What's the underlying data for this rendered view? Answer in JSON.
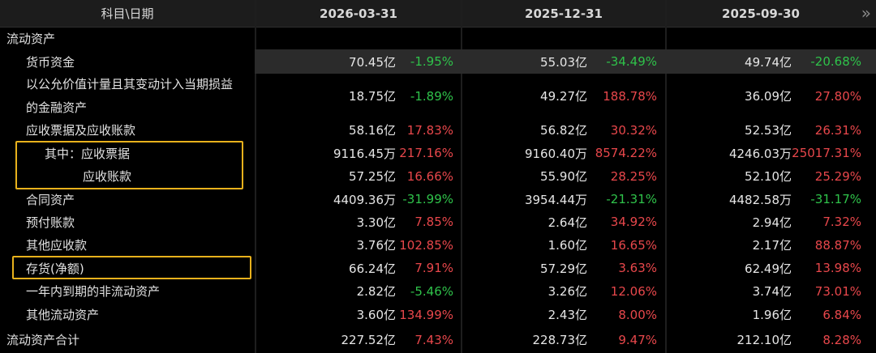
{
  "header": {
    "label": "科目\\日期",
    "columns": [
      "2026-03-31",
      "2025-12-31",
      "2025-09-30"
    ],
    "expand_icon": "»"
  },
  "rows": [
    {
      "label": "流动资产",
      "indent": 0,
      "cells": []
    },
    {
      "label": "货币资金",
      "indent": 1,
      "selected": true,
      "cells": [
        {
          "v": "70.45亿",
          "p": "-1.95%",
          "d": "down"
        },
        {
          "v": "55.03亿",
          "p": "-34.49%",
          "d": "down"
        },
        {
          "v": "49.74亿",
          "p": "-20.68%",
          "d": "down"
        }
      ]
    },
    {
      "label": "以公允价值计量且其变动计入当期损益",
      "label2": "的金融资产",
      "indent": 1,
      "cells": [
        {
          "v": "18.75亿",
          "p": "-1.89%",
          "d": "down"
        },
        {
          "v": "49.27亿",
          "p": "188.78%",
          "d": "up"
        },
        {
          "v": "36.09亿",
          "p": "27.80%",
          "d": "up"
        }
      ]
    },
    {
      "label": "应收票据及应收账款",
      "indent": 1,
      "cells": [
        {
          "v": "58.16亿",
          "p": "17.83%",
          "d": "up"
        },
        {
          "v": "56.82亿",
          "p": "30.32%",
          "d": "up"
        },
        {
          "v": "52.53亿",
          "p": "26.31%",
          "d": "up"
        }
      ]
    },
    {
      "label": "其中：应收票据",
      "indent": 2,
      "cells": [
        {
          "v": "9116.45万",
          "p": "217.16%",
          "d": "up"
        },
        {
          "v": "9160.40万",
          "p": "8574.22%",
          "d": "up"
        },
        {
          "v": "4246.03万",
          "p": "25017.31%",
          "d": "up"
        }
      ]
    },
    {
      "label": "应收账款",
      "indent": 3,
      "cells": [
        {
          "v": "57.25亿",
          "p": "16.66%",
          "d": "up"
        },
        {
          "v": "55.90亿",
          "p": "28.25%",
          "d": "up"
        },
        {
          "v": "52.10亿",
          "p": "25.29%",
          "d": "up"
        }
      ]
    },
    {
      "label": "合同资产",
      "indent": 1,
      "cells": [
        {
          "v": "4409.36万",
          "p": "-31.99%",
          "d": "down"
        },
        {
          "v": "3954.44万",
          "p": "-21.31%",
          "d": "down"
        },
        {
          "v": "4482.58万",
          "p": "-31.17%",
          "d": "down"
        }
      ]
    },
    {
      "label": "预付账款",
      "indent": 1,
      "cells": [
        {
          "v": "3.30亿",
          "p": "7.85%",
          "d": "up"
        },
        {
          "v": "2.64亿",
          "p": "34.92%",
          "d": "up"
        },
        {
          "v": "2.94亿",
          "p": "7.32%",
          "d": "up"
        }
      ]
    },
    {
      "label": "其他应收款",
      "indent": 1,
      "cells": [
        {
          "v": "3.76亿",
          "p": "102.85%",
          "d": "up"
        },
        {
          "v": "1.60亿",
          "p": "16.65%",
          "d": "up"
        },
        {
          "v": "2.17亿",
          "p": "88.87%",
          "d": "up"
        }
      ]
    },
    {
      "label": "存货(净额)",
      "indent": 1,
      "cells": [
        {
          "v": "66.24亿",
          "p": "7.91%",
          "d": "up"
        },
        {
          "v": "57.29亿",
          "p": "3.63%",
          "d": "up"
        },
        {
          "v": "62.49亿",
          "p": "13.98%",
          "d": "up"
        }
      ]
    },
    {
      "label": "一年内到期的非流动资产",
      "indent": 1,
      "cells": [
        {
          "v": "2.82亿",
          "p": "-5.46%",
          "d": "down"
        },
        {
          "v": "3.26亿",
          "p": "12.06%",
          "d": "up"
        },
        {
          "v": "3.74亿",
          "p": "73.01%",
          "d": "up"
        }
      ]
    },
    {
      "label": "其他流动资产",
      "indent": 1,
      "cells": [
        {
          "v": "3.60亿",
          "p": "134.99%",
          "d": "up"
        },
        {
          "v": "2.43亿",
          "p": "8.00%",
          "d": "up"
        },
        {
          "v": "1.96亿",
          "p": "6.84%",
          "d": "up"
        }
      ]
    },
    {
      "label": "流动资产合计",
      "indent": 0,
      "cells": [
        {
          "v": "227.52亿",
          "p": "7.43%",
          "d": "up"
        },
        {
          "v": "228.73亿",
          "p": "9.47%",
          "d": "up"
        },
        {
          "v": "212.10亿",
          "p": "8.28%",
          "d": "up"
        }
      ]
    }
  ],
  "colors": {
    "up": "#e8474b",
    "down": "#2fc24a",
    "highlight_box": "#e8b11c"
  }
}
